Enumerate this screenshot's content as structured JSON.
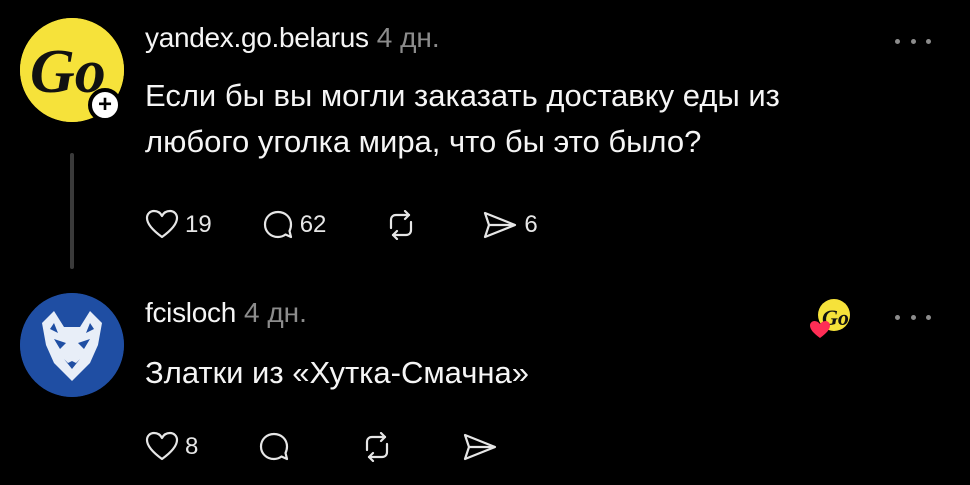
{
  "posts": [
    {
      "author": "yandex.go.belarus",
      "time": "4 дн.",
      "text_line1": "Если бы вы могли заказать доставку еды из",
      "text_line2": "любого уголка мира, что бы это было?",
      "likes": "19",
      "comments": "62",
      "shares": "6",
      "avatar_text": "Go",
      "avatar_color": "#f6e23a"
    },
    {
      "author": "fcisloch",
      "time": "4 дн.",
      "text_line1": "Златки из «Хутка-Смачна»",
      "likes": "8",
      "avatar_color": "#1f4ea3",
      "liked_by_badge_text": "Go"
    }
  ],
  "plus_label": "+"
}
